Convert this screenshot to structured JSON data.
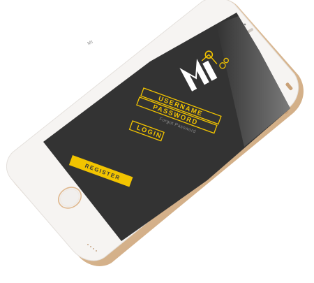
{
  "app": {
    "logo_text": "MI"
  },
  "login_form": {
    "username_placeholder": "USERNAME",
    "password_placeholder": "PASSWORD",
    "forgot_password_label": "Forgot Password",
    "login_label": "LOGIN"
  },
  "register": {
    "label": "REGISTER"
  },
  "colors": {
    "accent": "#f2c400",
    "screen_bg": "#333333",
    "phone_body": "#f4f1ee",
    "phone_rim": "#e2c7a8"
  }
}
